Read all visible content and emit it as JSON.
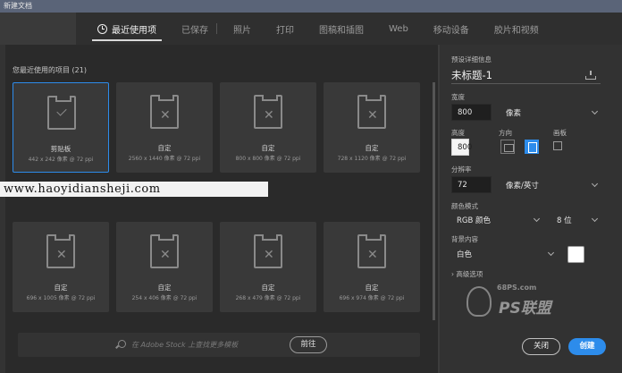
{
  "window": {
    "title": "新建文档"
  },
  "tabs": [
    {
      "label": "最近使用项",
      "active": true
    },
    {
      "label": "已保存"
    },
    {
      "label": "照片"
    },
    {
      "label": "打印"
    },
    {
      "label": "图稿和插图"
    },
    {
      "label": "Web"
    },
    {
      "label": "移动设备"
    },
    {
      "label": "胶片和视频"
    }
  ],
  "recent": {
    "title": "您最近使用的项目 (21)",
    "items": [
      {
        "name": "剪贴板",
        "size": "442 x 242 像素 @ 72 ppi",
        "icon": "clipboard-check-icon",
        "selected": true
      },
      {
        "name": "自定",
        "size": "2560 x 1440 像素 @ 72 ppi",
        "icon": "custom-document-icon"
      },
      {
        "name": "自定",
        "size": "800 x 800 像素 @ 72 ppi",
        "icon": "custom-document-icon"
      },
      {
        "name": "自定",
        "size": "728 x 1120 像素 @ 72 ppi",
        "icon": "custom-document-icon"
      },
      {
        "name": "自定",
        "size": "696 x 1005 像素 @ 72 ppi",
        "icon": "custom-document-icon"
      },
      {
        "name": "自定",
        "size": "254 x 406 像素 @ 72 ppi",
        "icon": "custom-document-icon"
      },
      {
        "name": "自定",
        "size": "268 x 479 像素 @ 72 ppi",
        "icon": "custom-document-icon"
      },
      {
        "name": "自定",
        "size": "696 x 974 像素 @ 72 ppi",
        "icon": "custom-document-icon"
      }
    ]
  },
  "search": {
    "placeholder": "在 Adobe Stock 上查找更多模板",
    "go_label": "前往"
  },
  "details": {
    "section_title": "预设详细信息",
    "preset_name": "未标题-1",
    "width_label": "宽度",
    "width_value": "800",
    "width_unit": "像素",
    "height_label": "高度",
    "height_value": "800",
    "orientation_label": "方向",
    "artboard_label": "画板",
    "resolution_label": "分辨率",
    "resolution_value": "72",
    "resolution_unit": "像素/英寸",
    "color_mode_label": "颜色模式",
    "color_mode_value": "RGB 颜色",
    "bit_depth_value": "8 位",
    "background_label": "背景内容",
    "background_value": "白色",
    "background_color": "#ffffff",
    "advanced_label": "高级选项",
    "close_label": "关闭",
    "create_label": "创建"
  },
  "watermarks": {
    "url": "www.haoyidiansheji.com",
    "site_small": "68PS.com",
    "site_big": "PS联盟"
  },
  "colors": {
    "accent": "#2d8ceb",
    "panel": "#323232",
    "main": "#2a2a2a"
  }
}
